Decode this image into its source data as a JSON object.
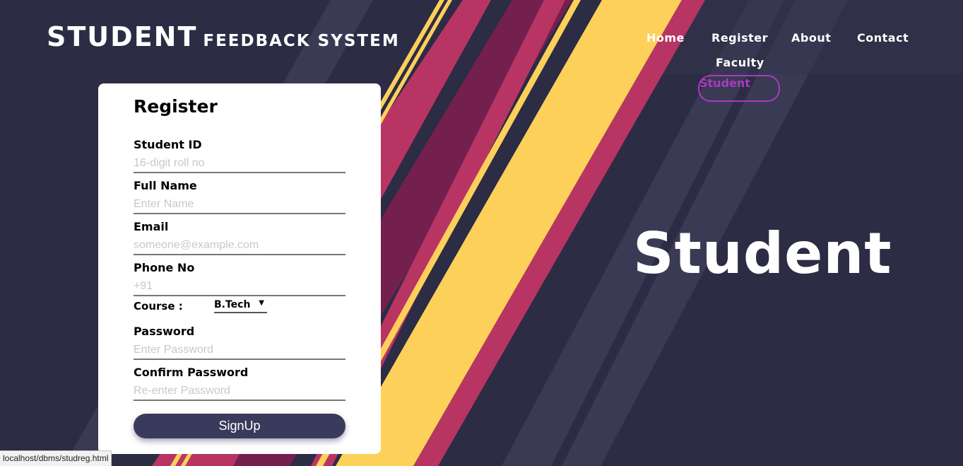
{
  "brand": {
    "main": "STUDENT",
    "sub": "FEEDBACK SYSTEM"
  },
  "nav": {
    "home": "Home",
    "register": "Register",
    "about": "About",
    "contact": "Contact",
    "faculty": "Faculty",
    "student": "Student"
  },
  "hero": {
    "title": "Student"
  },
  "form": {
    "title": "Register",
    "student_id": {
      "label": "Student ID",
      "placeholder": "16-digit roll no",
      "value": ""
    },
    "full_name": {
      "label": "Full Name",
      "placeholder": "Enter Name",
      "value": ""
    },
    "email": {
      "label": "Email",
      "placeholder": "someone@example.com",
      "value": ""
    },
    "phone": {
      "label": "Phone No",
      "placeholder": "+91",
      "value": ""
    },
    "course": {
      "label": "Course :",
      "selected": "B.Tech"
    },
    "password": {
      "label": "Password",
      "placeholder": "Enter Password",
      "value": ""
    },
    "confirm_password": {
      "label": "Confirm Password",
      "placeholder": "Re-enter Password",
      "value": ""
    },
    "submit_label": "SignUp"
  },
  "statusbar": {
    "url": "localhost/dbms/studreg.html"
  },
  "colors": {
    "background": "#2c2c44",
    "stripe_pink": "#b83563",
    "stripe_maroon": "#73204f",
    "stripe_yellow": "#fdd05a",
    "stripe_slate": "#3a3a54",
    "accent_purple": "#a83bc0",
    "button": "#3a3a5c"
  }
}
